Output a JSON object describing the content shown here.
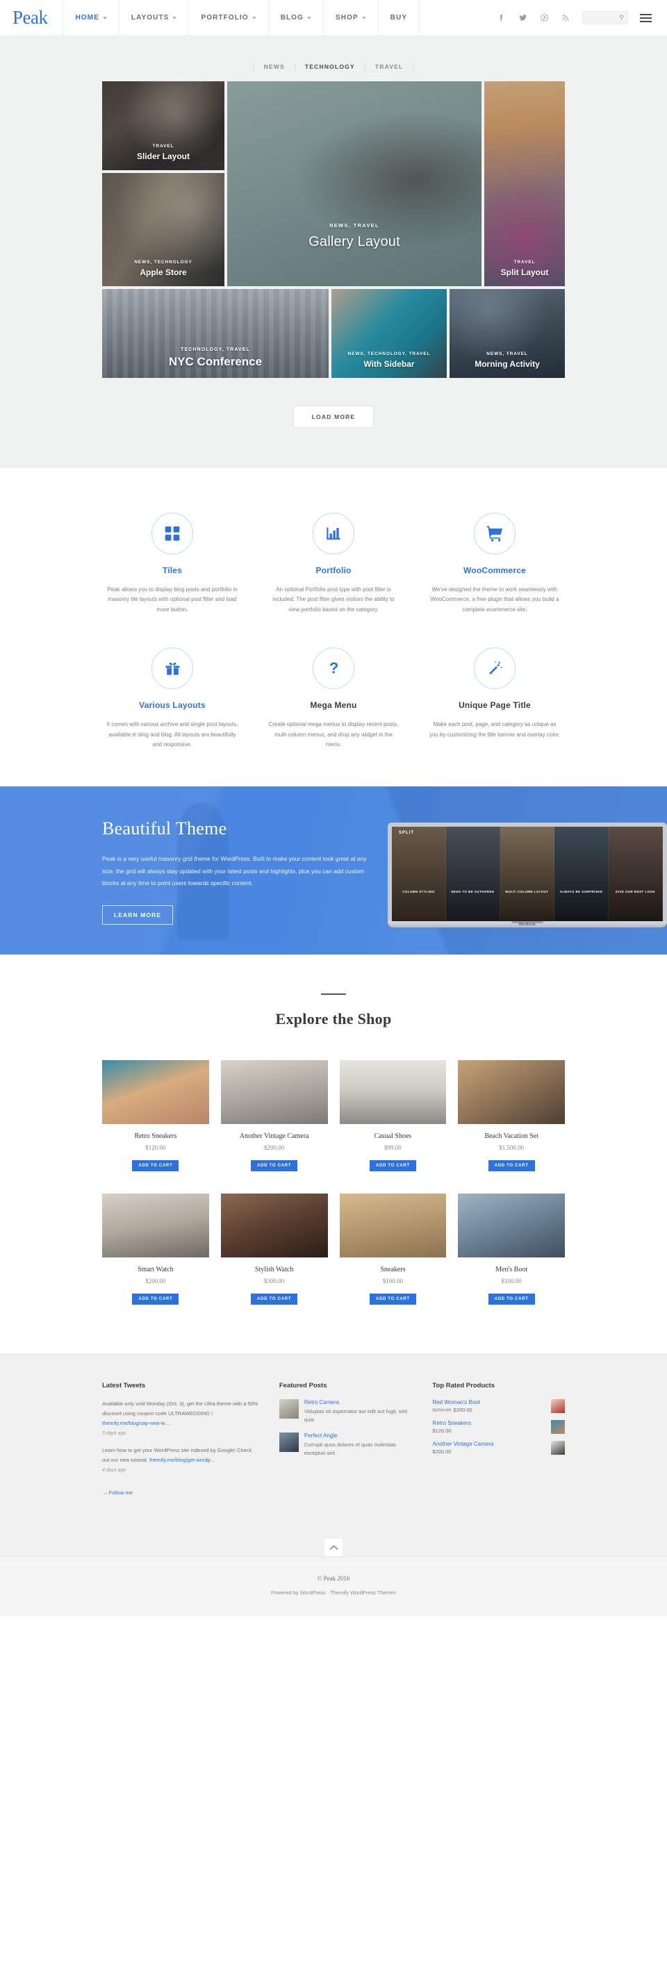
{
  "header": {
    "logo": "Peak",
    "nav": [
      {
        "label": "HOME",
        "has_caret": true,
        "active": true
      },
      {
        "label": "LAYOUTS",
        "has_caret": true,
        "active": false
      },
      {
        "label": "PORTFOLIO",
        "has_caret": true,
        "active": false
      },
      {
        "label": "BLOG",
        "has_caret": true,
        "active": false
      },
      {
        "label": "SHOP",
        "has_caret": true,
        "active": false
      },
      {
        "label": "BUY",
        "has_caret": false,
        "active": false
      }
    ],
    "social": [
      "facebook-icon",
      "twitter-icon",
      "pinterest-icon",
      "rss-icon"
    ],
    "search_placeholder": "",
    "search_value": "",
    "menu_icon": "hamburger-icon"
  },
  "hero": {
    "filters": [
      {
        "label": "NEWS",
        "active": false
      },
      {
        "label": "TECHNOLOGY",
        "active": true
      },
      {
        "label": "TRAVEL",
        "active": false
      }
    ],
    "tiles": [
      {
        "cats": "TRAVEL",
        "title": "Slider Layout"
      },
      {
        "cats": "NEWS, TECHNOLOGY",
        "title": "Apple Store"
      },
      {
        "cats": "NEWS, TRAVEL",
        "title": "Gallery Layout"
      },
      {
        "cats": "TRAVEL",
        "title": "Split Layout"
      },
      {
        "cats": "TECHNOLOGY, TRAVEL",
        "title": "NYC Conference"
      },
      {
        "cats": "NEWS, TECHNOLOGY, TRAVEL",
        "title": "With Sidebar"
      },
      {
        "cats": "NEWS, TRAVEL",
        "title": "Morning Activity"
      }
    ],
    "load_more": "LOAD MORE"
  },
  "features": [
    {
      "icon": "tiles-grid-icon",
      "title": "Tiles",
      "accent": true,
      "desc": "Peak allows you to display blog posts and portfolio in masonry tile layouts with optional post filter and load more button."
    },
    {
      "icon": "bar-chart-icon",
      "title": "Portfolio",
      "accent": true,
      "desc": "An optional Portfolio post type with post filter is included. The post filter gives visitors the ability to view portfolio based on the category."
    },
    {
      "icon": "shopping-cart-icon",
      "title": "WooCommerce",
      "accent": true,
      "desc": "We've designed the theme to work seamlessly with WooCommerce, a free plugin that allows you build a complete ecommerce site."
    },
    {
      "icon": "gift-icon",
      "title": "Various Layouts",
      "accent": true,
      "desc": "It comes with various archive and single post layouts, available in blog and blog. All layouts are beautifully and responsive."
    },
    {
      "icon": "question-mark-icon",
      "title": "Mega Menu",
      "accent": false,
      "desc": "Create optional mega menus to display recent posts, multi-column menus, and drop any widget in the menu."
    },
    {
      "icon": "magic-wand-icon",
      "title": "Unique Page Title",
      "accent": false,
      "desc": "Make each post, page, and category as unique as you by customizing the title banner and overlay color."
    }
  ],
  "promo": {
    "title": "Beautiful Theme",
    "text": "Peak is a very useful masonry grid theme for WordPress. Built to make your content look great at any size, the grid will always stay updated with your latest posts and highlights, plus you can add custom blocks at any time to point users towards specific content.",
    "button": "LEARN MORE",
    "screen_label": "SPLIT",
    "movies": [
      "Column Styling",
      "Need To Be Authored",
      "Multi Column Layout",
      "Always Be Surprised",
      "Give Our Best Look"
    ],
    "laptop_foot": "MacBook"
  },
  "shop": {
    "title": "Explore the Shop",
    "add_to_cart": "ADD TO CART",
    "products": [
      {
        "name": "Retro Sneakers",
        "price": "$120.00",
        "img": "pi1"
      },
      {
        "name": "Another Vintage Camera",
        "price": "$200.00",
        "img": "pi2"
      },
      {
        "name": "Casual Shoes",
        "price": "$99.00",
        "img": "pi3"
      },
      {
        "name": "Beach Vacation Set",
        "price": "$1,500.00",
        "img": "pi4"
      },
      {
        "name": "Smart Watch",
        "price": "$200.00",
        "img": "pi5"
      },
      {
        "name": "Stylish Watch",
        "price": "$300.00",
        "img": "pi6"
      },
      {
        "name": "Sneakers",
        "price": "$100.00",
        "img": "pi7"
      },
      {
        "name": "Men's Boot",
        "price": "$100.00",
        "img": "pi8"
      }
    ]
  },
  "footer": {
    "tweets_title": "Latest Tweets",
    "tweets": [
      {
        "text": "Available only until Monday (Oct. 3), get the Ultra theme with a 50% discount using coupon code ULTRAWEDDING ! ",
        "link": "themify.me/blog/say-new-w…",
        "time": "3 days ago"
      },
      {
        "text": "Learn how to get your WordPress site indexed by Google! Check out our new tutorial. ",
        "link": "themify.me/blog/get-wordp…",
        "time": "4 days ago"
      }
    ],
    "follow": "→ Follow me",
    "featured_title": "Featured Posts",
    "featured": [
      {
        "title": "Retro Camera",
        "desc": "Voluptas sit aspernatur aut odit aut fugit, sed quia",
        "thumb": "fp1"
      },
      {
        "title": "Perfect Angle",
        "desc": "Corrupti quos dolores et quas molestias excepturi sint",
        "thumb": "fp2"
      }
    ],
    "top_rated_title": "Top Rated Products",
    "top_rated": [
      {
        "name": "Red Woman's Boot",
        "old_price": "$250.00",
        "price": "$200.00",
        "thumb": "tp1"
      },
      {
        "name": "Retro Sneakers",
        "old_price": "",
        "price": "$120.00",
        "thumb": "tp2"
      },
      {
        "name": "Another Vintage Camera",
        "old_price": "",
        "price": "$200.00",
        "thumb": "tp3"
      }
    ],
    "back_to_top": "chevron-up-icon",
    "copyright": "© Peak 2016",
    "powered": "Powered by WordPress · Themify WordPress Themes"
  },
  "colors": {
    "accent": "#2b72e0",
    "text": "#555555",
    "muted": "#8a8a8a",
    "hero_bg": "#f0f1f1"
  }
}
